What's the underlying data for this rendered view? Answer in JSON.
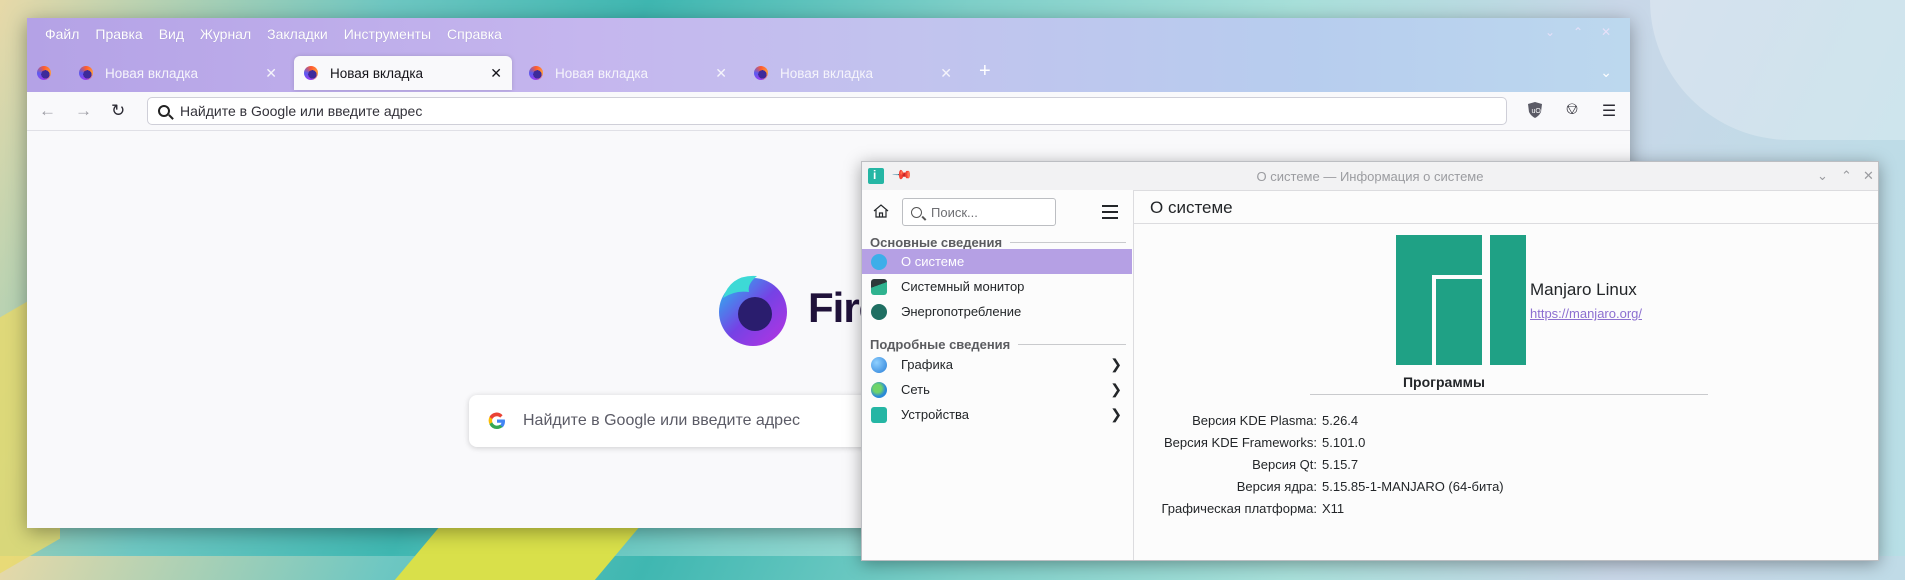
{
  "firefox": {
    "menu": [
      {
        "label": "Файл"
      },
      {
        "label": "Правка"
      },
      {
        "label": "Вид"
      },
      {
        "label": "Журнал"
      },
      {
        "label": "Закладки"
      },
      {
        "label": "Инструменты"
      },
      {
        "label": "Справка"
      }
    ],
    "tabs": [
      {
        "label": "Новая вкладка",
        "active": false
      },
      {
        "label": "Новая вкладка",
        "active": true
      },
      {
        "label": "Новая вкладка",
        "active": false
      },
      {
        "label": "Новая вкладка",
        "active": false
      }
    ],
    "urlbar": {
      "placeholder": "Найдите в Google или введите адрес"
    },
    "newtab": {
      "wordmark": "Fire",
      "search_placeholder": "Найдите в Google или введите адрес"
    }
  },
  "infocenter": {
    "window_title": "О системе — Информация о системе",
    "search_placeholder": "Поиск...",
    "sections": [
      {
        "title": "Основные сведения",
        "items": [
          {
            "label": "О системе",
            "selected": true,
            "icon": "info-icon"
          },
          {
            "label": "Системный монитор",
            "selected": false,
            "icon": "system-monitor-icon"
          },
          {
            "label": "Энергопотребление",
            "selected": false,
            "icon": "energy-icon"
          }
        ]
      },
      {
        "title": "Подробные сведения",
        "items": [
          {
            "label": "Графика",
            "icon": "graphics-icon",
            "has_children": true
          },
          {
            "label": "Сеть",
            "icon": "network-icon",
            "has_children": true
          },
          {
            "label": "Устройства",
            "icon": "devices-icon",
            "has_children": true
          }
        ]
      }
    ],
    "page_title": "О системе",
    "distro": {
      "name": "Manjaro Linux",
      "url": "https://manjaro.org/"
    },
    "programs_title": "Программы",
    "programs": [
      {
        "key": "Версия KDE Plasma:",
        "value": "5.26.4"
      },
      {
        "key": "Версия KDE Frameworks:",
        "value": "5.101.0"
      },
      {
        "key": "Версия Qt:",
        "value": "5.15.7"
      },
      {
        "key": "Версия ядра:",
        "value": "5.15.85-1-MANJARO (64-бита)"
      },
      {
        "key": "Графическая платформа:",
        "value": "X11"
      }
    ]
  },
  "colors": {
    "accent": "#b5a0e4",
    "manjaro_green": "#1fa185",
    "link": "#8c6fd0"
  }
}
